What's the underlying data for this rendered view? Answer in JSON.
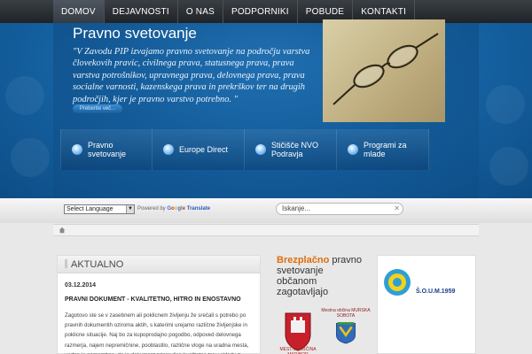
{
  "nav": [
    "DOMOV",
    "DEJAVNOSTI",
    "O NAS",
    "PODPORNIKI",
    "POBUDE",
    "KONTAKTI"
  ],
  "hero": {
    "title": "Pravno svetovanje",
    "text": "\"V Zavodu PIP izvajamo pravno svetovanje na področju varstva človekovih pravic, civilnega prava, statusnega prava, prava varstva potrošnikov, upravnega prava, delovnega prava, prava socialne varnosti, kazenskega prava in prekrškov ter na drugih področjih, kjer je pravno varstvo potrebno. \"",
    "more_label": "Preberite več..."
  },
  "quick_links": [
    "Pravno svetovanje",
    "Europe Direct",
    "Stičišče NVO Podravja",
    "Programi za mlade"
  ],
  "translate": {
    "select_label": "Select Language",
    "powered_by": "Powered by",
    "translate_word": "Translate"
  },
  "search": {
    "placeholder": "Iskanje..."
  },
  "news": {
    "heading": "AKTUALNO",
    "date": "03.12.2014",
    "title": "PRAVNI DOKUMENT - KVALITETNO, HITRO IN ENOSTAVNO",
    "text": "Zagotovo ste se v zasebnem ali poklicnem življenju že srečali s potrebo po pravnih dokumentih oziroma aktih, s katerimi urejamo različne življenjske in poklicne situacije. Naj bo za kupoprodajno pogodbo, odpoved delovnega razmerja, najem nepremičnine, pooblastilo, različne vloge na uradna mesta, vedno je pomembno, da je dokument pripravljen kvalitetno ter v skladu z"
  },
  "promo": {
    "highlight": "Brezplačno",
    "text": "pravno svetovanje občanom zagotavljajo",
    "crest1_label": "MESTNA OBČINA MARIBOR",
    "crest2_label": "Mestna občina MURSKA SOBOTA"
  },
  "partner": {
    "label": "Š.O.U.M.1959"
  },
  "colors": {
    "hero_blue": "#1766a8",
    "promo_orange": "#e06d0a"
  }
}
